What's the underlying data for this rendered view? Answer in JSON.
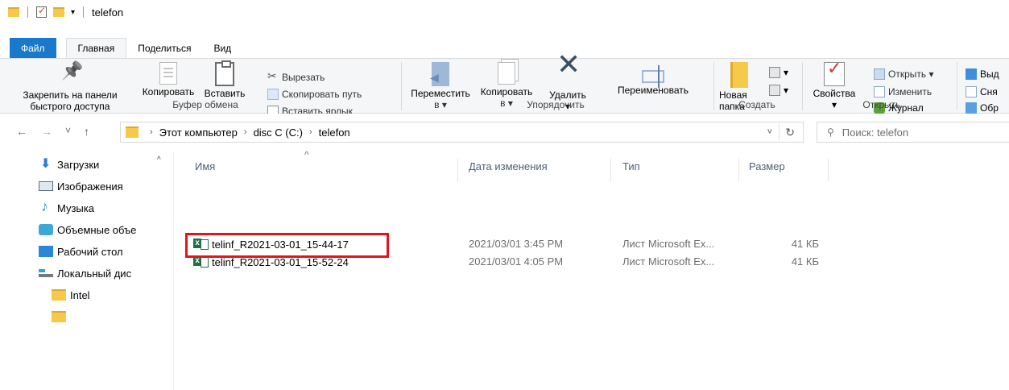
{
  "window": {
    "title": "telefon"
  },
  "tabs": [
    {
      "label": "Файл"
    },
    {
      "label": "Главная"
    },
    {
      "label": "Поделиться"
    },
    {
      "label": "Вид"
    }
  ],
  "ribbon": {
    "clipboard": {
      "pin_label_1": "Закрепить на панели",
      "pin_label_2": "быстрого доступа",
      "copy_label": "Копировать",
      "paste_label": "Вставить",
      "cut_label": "Вырезать",
      "copy_path_label": "Скопировать путь",
      "paste_shortcut_label": "Вставить ярлык",
      "group_label": "Буфер обмена"
    },
    "organize": {
      "move_label_1": "Переместить",
      "move_label_2": "в ▾",
      "copy_label_1": "Копировать",
      "copy_label_2": "в ▾",
      "delete_label": "Удалить",
      "delete_arrow": "▾",
      "rename_label": "Переименовать",
      "group_label": "Упорядочить"
    },
    "create": {
      "new_folder_label_1": "Новая",
      "new_folder_label_2": "папка",
      "group_label": "Создать"
    },
    "open": {
      "properties_label": "Свойства",
      "properties_arrow": "▾",
      "open_label": "Открыть ▾",
      "edit_label": "Изменить",
      "history_label": "Журнал",
      "group_label": "Открыть"
    },
    "select": {
      "item1": "Выд",
      "item2": "Сня",
      "item3": "Обр"
    }
  },
  "nav": {
    "back": "←",
    "forward": "→",
    "recent": "˅",
    "up": "↑",
    "breadcrumb": [
      "Этот компьютер",
      "disc C (C:)",
      "telefon"
    ],
    "search_placeholder": "Поиск: telefon"
  },
  "navpane": {
    "items": [
      {
        "label": "Загрузки",
        "icon": "download-icon"
      },
      {
        "label": "Изображения",
        "icon": "images-icon"
      },
      {
        "label": "Музыка",
        "icon": "music-icon"
      },
      {
        "label": "Объемные объе",
        "icon": "3d-objects-icon"
      },
      {
        "label": "Рабочий стол",
        "icon": "desktop-icon"
      },
      {
        "label": "Локальный дис",
        "icon": "local-disk-icon"
      },
      {
        "label": "Intel",
        "icon": "folder-icon"
      }
    ]
  },
  "filelist": {
    "columns": {
      "name": "Имя",
      "date": "Дата изменения",
      "type": "Тип",
      "size": "Размер"
    },
    "rows": [
      {
        "name": "telinf_R2021-03-01_15-44-17",
        "date": "2021/03/01 3:45 PM",
        "type": "Лист Microsoft Ex...",
        "size": "41 КБ"
      },
      {
        "name": "telinf_R2021-03-01_15-52-24",
        "date": "2021/03/01 4:05 PM",
        "type": "Лист Microsoft Ex...",
        "size": "41 КБ"
      }
    ]
  },
  "colors": {
    "file_tab": "#1979ca",
    "highlight": "#e4141b",
    "ribbon_bg": "#f5f6f7",
    "folder": "#f7c94a"
  }
}
